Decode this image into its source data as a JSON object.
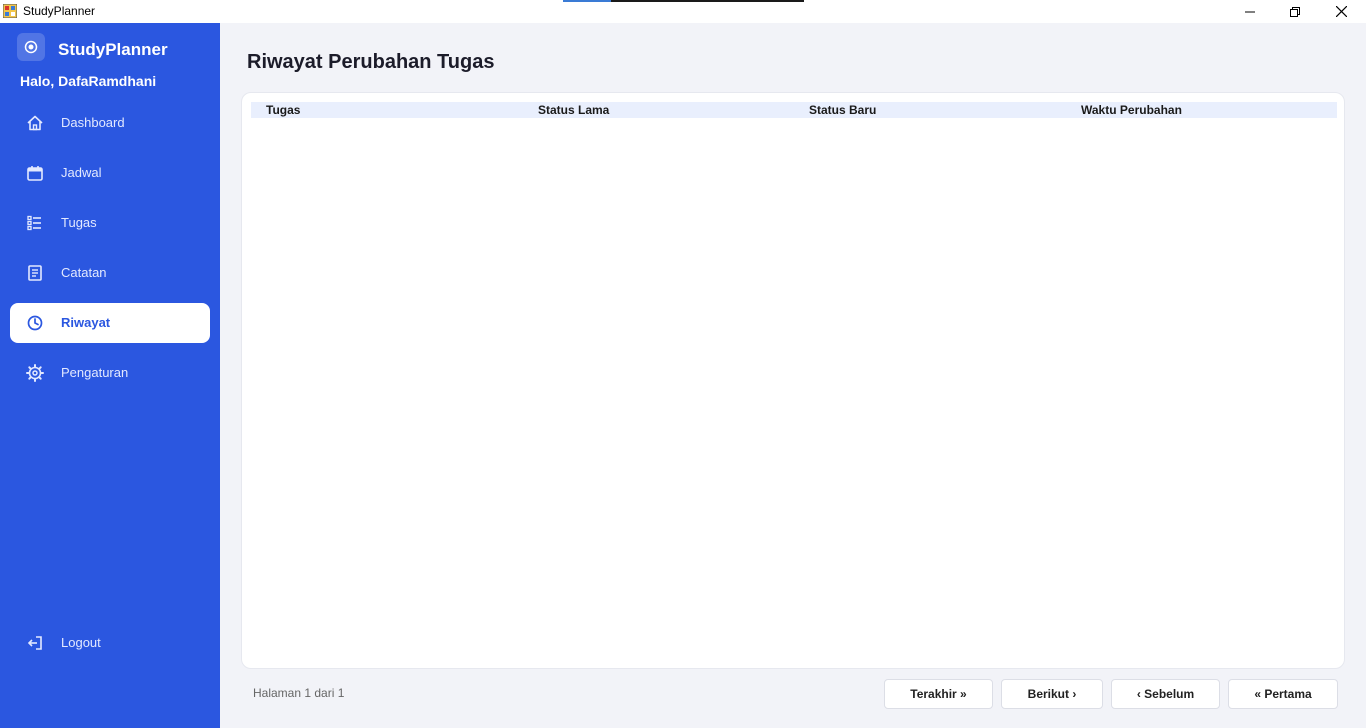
{
  "window": {
    "title": "StudyPlanner",
    "minimize_icon": "minimize-icon",
    "maximize_icon": "restore-icon",
    "close_icon": "close-icon"
  },
  "sidebar": {
    "brand": "StudyPlanner",
    "greeting": "Halo, DafaRamdhani",
    "items": [
      {
        "label": "Dashboard",
        "icon": "home-icon",
        "active": false
      },
      {
        "label": "Jadwal",
        "icon": "calendar-icon",
        "active": false
      },
      {
        "label": "Tugas",
        "icon": "task-list-icon",
        "active": false
      },
      {
        "label": "Catatan",
        "icon": "notes-icon",
        "active": false
      },
      {
        "label": "Riwayat",
        "icon": "history-icon",
        "active": true
      },
      {
        "label": "Pengaturan",
        "icon": "gear-icon",
        "active": false
      }
    ],
    "logout": {
      "label": "Logout",
      "icon": "logout-icon"
    }
  },
  "main": {
    "title": "Riwayat Perubahan Tugas",
    "table": {
      "columns": [
        "Tugas",
        "Status Lama",
        "Status Baru",
        "Waktu Perubahan"
      ],
      "rows": []
    },
    "pagination": {
      "info": "Halaman 1 dari 1",
      "last": "Terakhir »",
      "next": "Berikut ›",
      "prev": "‹ Sebelum",
      "first": "« Pertama"
    }
  },
  "colors": {
    "sidebar": "#2b57e0",
    "background": "#f2f3f8",
    "header_row": "#e9effd"
  }
}
